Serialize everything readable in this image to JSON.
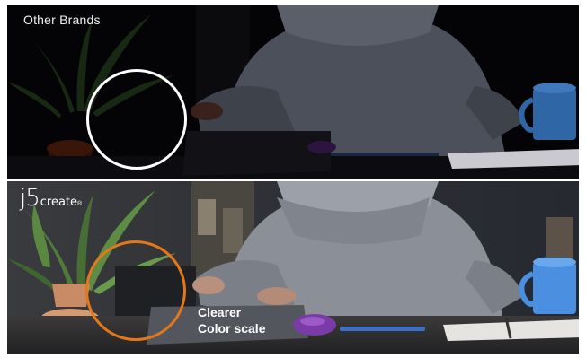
{
  "comparison": {
    "top": {
      "label": "Other Brands",
      "ring_color": "#ffffff"
    },
    "bottom": {
      "logo_main": "j5",
      "logo_sub": "create",
      "logo_mark": "®",
      "caption_line1": "Clearer",
      "caption_line2": "Color scale",
      "ring_color": "#e2781a"
    }
  }
}
